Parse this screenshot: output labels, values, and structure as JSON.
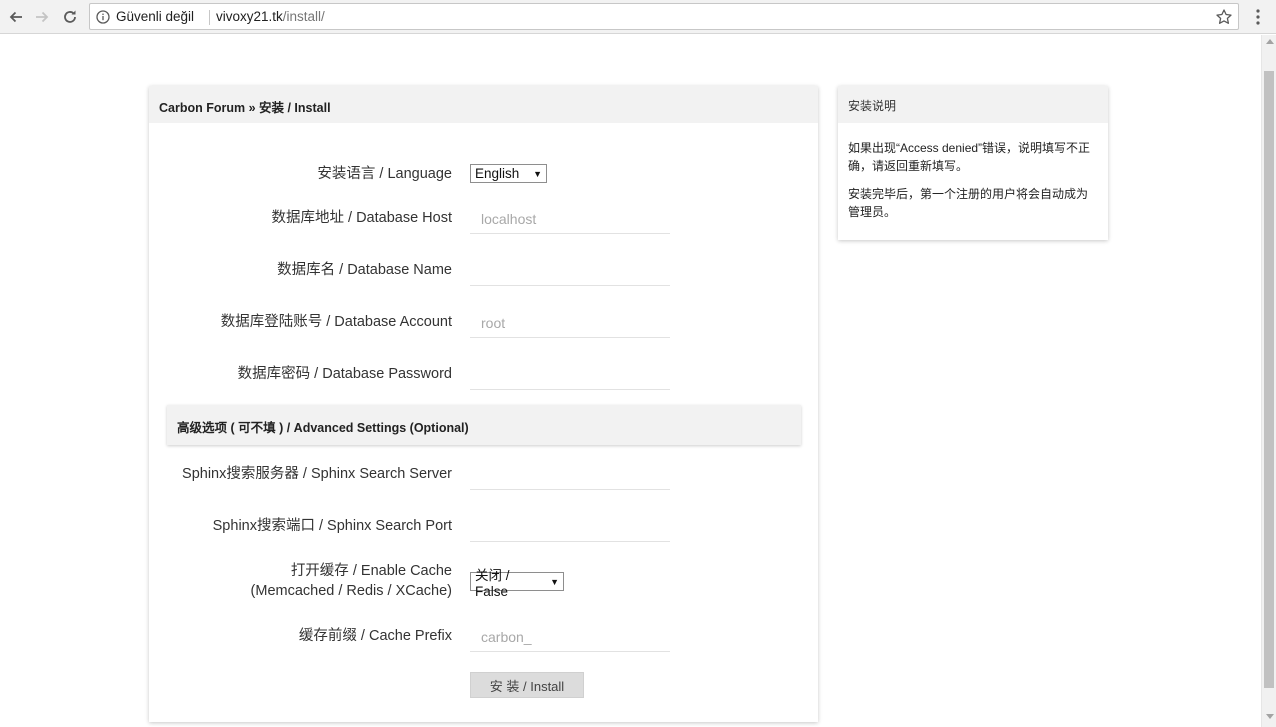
{
  "browser": {
    "security_text": "Güvenli değil",
    "url_host": "vivoxy21.tk",
    "url_path": "/install/"
  },
  "main": {
    "title": "Carbon Forum » 安装 / Install",
    "fields": {
      "language": {
        "label": "安装语言 / Language",
        "value": "English"
      },
      "db_host": {
        "label": "数据库地址 / Database Host",
        "placeholder": "localhost"
      },
      "db_name": {
        "label": "数据库名 / Database Name",
        "placeholder": ""
      },
      "db_account": {
        "label": "数据库登陆账号 / Database Account",
        "placeholder": "root"
      },
      "db_password": {
        "label": "数据库密码 / Database Password",
        "placeholder": ""
      },
      "sphinx_server": {
        "label": "Sphinx搜索服务器 / Sphinx Search Server",
        "placeholder": ""
      },
      "sphinx_port": {
        "label": "Sphinx搜索端口 / Sphinx Search Port",
        "placeholder": ""
      },
      "cache": {
        "label_line1": "打开缓存 / Enable Cache",
        "label_line2": "(Memcached / Redis / XCache)",
        "value": "关闭 / False"
      },
      "cache_prefix": {
        "label": "缓存前缀 / Cache Prefix",
        "placeholder": "carbon_"
      }
    },
    "advanced_title": "高级选项 ( 可不填 ) / Advanced Settings (Optional)",
    "install_label": "安 装 / Install"
  },
  "sidebar": {
    "title": "安装说明",
    "paragraphs": [
      "如果出现“Access denied”错误，说明填写不正确，请返回重新填写。",
      "安装完毕后，第一个注册的用户将会自动成为管理员。"
    ]
  },
  "icons": {
    "back": "back-arrow-icon",
    "forward": "forward-arrow-icon",
    "reload": "reload-icon",
    "info": "info-icon",
    "bookmark": "star-icon",
    "menu": "vertical-dots-icon",
    "dropdown": "dropdown-arrow-icon"
  }
}
